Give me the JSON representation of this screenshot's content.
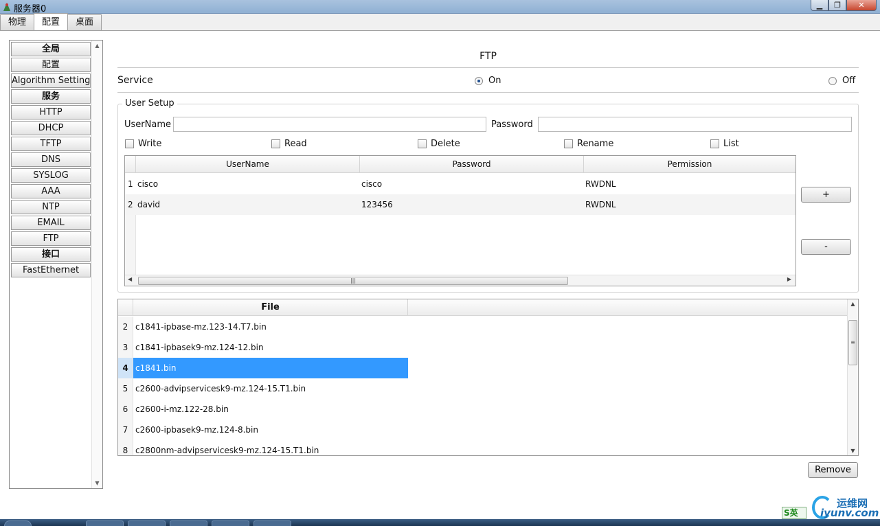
{
  "window": {
    "title": "服务器0",
    "buttons": {
      "minimize": "▁",
      "maximize": "❐",
      "close": "✕"
    }
  },
  "tabs": [
    {
      "label": "物理",
      "active": false
    },
    {
      "label": "配置",
      "active": true
    },
    {
      "label": "桌面",
      "active": false
    }
  ],
  "sidebar": {
    "items": [
      {
        "label": "全局",
        "header": true
      },
      {
        "label": "配置",
        "header": false
      },
      {
        "label": "Algorithm Settings",
        "header": false
      },
      {
        "label": "服务",
        "header": true
      },
      {
        "label": "HTTP",
        "header": false
      },
      {
        "label": "DHCP",
        "header": false
      },
      {
        "label": "TFTP",
        "header": false
      },
      {
        "label": "DNS",
        "header": false
      },
      {
        "label": "SYSLOG",
        "header": false
      },
      {
        "label": "AAA",
        "header": false
      },
      {
        "label": "NTP",
        "header": false
      },
      {
        "label": "EMAIL",
        "header": false
      },
      {
        "label": "FTP",
        "header": false
      },
      {
        "label": "接口",
        "header": true
      },
      {
        "label": "FastEthernet",
        "header": false
      }
    ]
  },
  "ftp": {
    "title": "FTP",
    "service_label": "Service",
    "on_label": "On",
    "off_label": "Off",
    "service_state": "On"
  },
  "user_setup": {
    "title": "User Setup",
    "username_label": "UserName",
    "username_value": "",
    "password_label": "Password",
    "password_value": "",
    "permissions": [
      {
        "label": "Write",
        "checked": false
      },
      {
        "label": "Read",
        "checked": false
      },
      {
        "label": "Delete",
        "checked": false
      },
      {
        "label": "Rename",
        "checked": false
      },
      {
        "label": "List",
        "checked": false
      }
    ],
    "columns": [
      "UserName",
      "Password",
      "Permission"
    ],
    "rows": [
      {
        "num": "1",
        "username": "cisco",
        "password": "cisco",
        "permission": "RWDNL"
      },
      {
        "num": "2",
        "username": "david",
        "password": "123456",
        "permission": "RWDNL"
      }
    ],
    "add_label": "+",
    "remove_label": "-"
  },
  "files": {
    "column": "File",
    "rows": [
      {
        "num": "2",
        "name": "c1841-ipbase-mz.123-14.T7.bin",
        "selected": false
      },
      {
        "num": "3",
        "name": "c1841-ipbasek9-mz.124-12.bin",
        "selected": false
      },
      {
        "num": "4",
        "name": "c1841.bin",
        "selected": true
      },
      {
        "num": "5",
        "name": "c2600-advipservicesk9-mz.124-15.T1.bin",
        "selected": false
      },
      {
        "num": "6",
        "name": "c2600-i-mz.122-28.bin",
        "selected": false
      },
      {
        "num": "7",
        "name": "c2600-ipbasek9-mz.124-8.bin",
        "selected": false
      },
      {
        "num": "8",
        "name": "c2800nm-advipservicesk9-mz.124-15.T1.bin",
        "selected": false
      }
    ],
    "remove_label": "Remove"
  },
  "watermark": {
    "ime": "S英",
    "line1": "运维网",
    "line2": "iyunv.com"
  },
  "colors": {
    "selection": "#3399ff",
    "titlebar": "#9bb8da",
    "radio_dot": "#1f4f8f"
  }
}
